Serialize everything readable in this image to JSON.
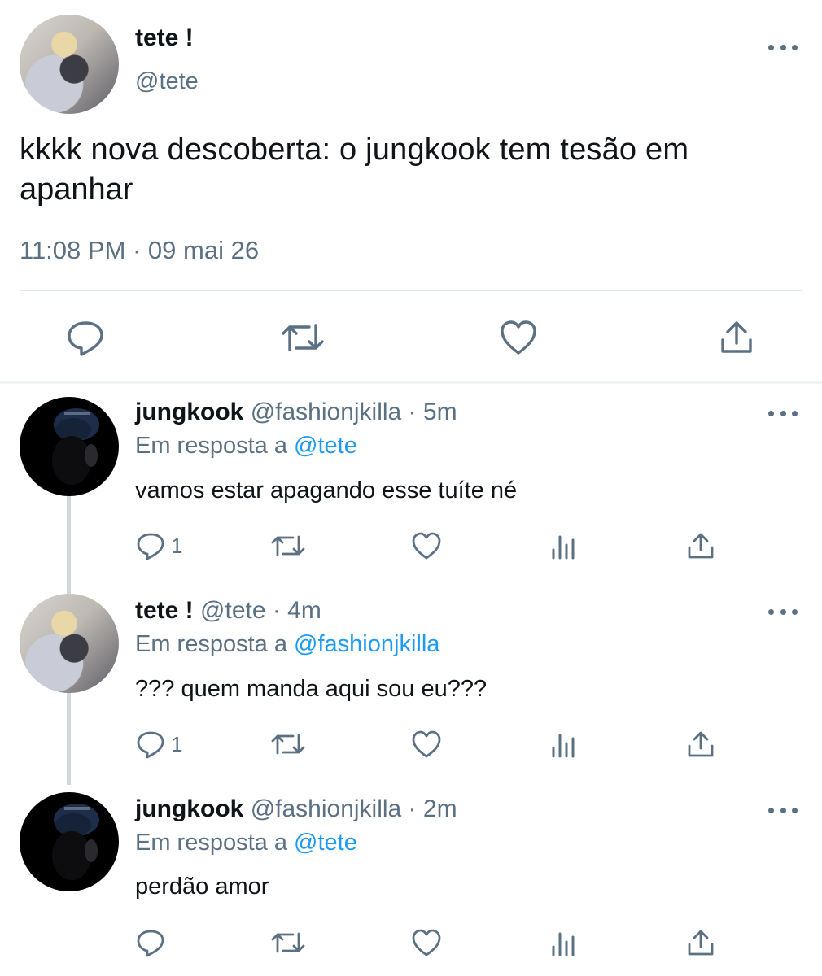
{
  "main_tweet": {
    "display_name": "tete !",
    "handle": "@tete",
    "text_line1": "kkkk nova descoberta: o jungkook tem tesão em",
    "text_line2": "apanhar",
    "timestamp": "11:08 PM · 09 mai 26",
    "more_icon": "more-horizontal-icon",
    "actions": [
      "reply-icon",
      "retweet-icon",
      "like-icon",
      "share-icon"
    ]
  },
  "replies": [
    {
      "display_name": "jungkook",
      "meta": "@fashionjkilla · 5m",
      "reply_to_prefix": "Em resposta a",
      "reply_to_handle": "@tete",
      "text": "vamos estar apagando esse tuíte né",
      "reply_count": "1"
    },
    {
      "display_name": "tete !",
      "meta": "@tete · 4m",
      "reply_to_prefix": "Em resposta a",
      "reply_to_handle": "@fashionjkilla",
      "text": "??? quem manda aqui sou eu???",
      "reply_count": "1"
    },
    {
      "display_name": "jungkook",
      "meta": "@fashionjkilla · 2m",
      "reply_to_prefix": "Em resposta a",
      "reply_to_handle": "@tete",
      "text": "perdão amor",
      "reply_count": ""
    }
  ],
  "colors": {
    "text": "#0f1419",
    "secondary": "#5b7083",
    "link": "#1d9bf0",
    "divider": "#e1e8ed"
  }
}
